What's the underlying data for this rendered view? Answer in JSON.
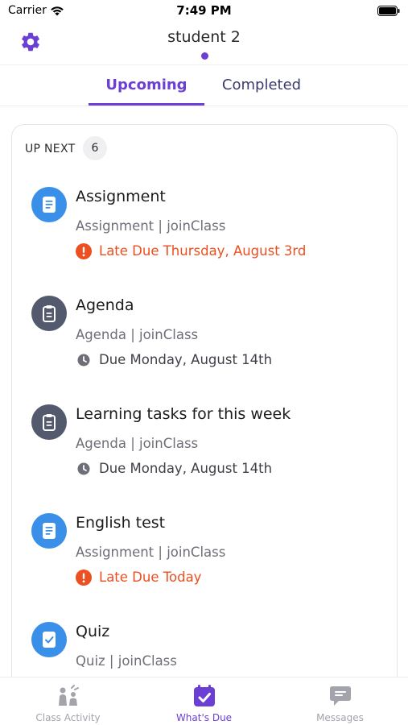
{
  "status_bar": {
    "carrier": "Carrier",
    "time": "7:49 PM"
  },
  "header": {
    "title": "student 2",
    "settings_icon": "gear-icon"
  },
  "tabs": [
    {
      "label": "Upcoming",
      "active": true
    },
    {
      "label": "Completed",
      "active": false
    }
  ],
  "section": {
    "label": "UP NEXT",
    "count": "6"
  },
  "items": [
    {
      "title": "Assignment",
      "subtitle": "Assignment | joinClass",
      "due": "Late Due Thursday, August 3rd",
      "late": true,
      "icon": "document-icon"
    },
    {
      "title": "Agenda",
      "subtitle": "Agenda | joinClass",
      "due": "Due Monday, August 14th",
      "late": false,
      "icon": "clipboard-icon"
    },
    {
      "title": "Learning tasks for this week",
      "subtitle": "Agenda | joinClass",
      "due": "Due Monday, August 14th",
      "late": false,
      "icon": "clipboard-icon"
    },
    {
      "title": "English test",
      "subtitle": "Assignment | joinClass",
      "due": "Late Due Today",
      "late": true,
      "icon": "document-icon"
    },
    {
      "title": "Quiz",
      "subtitle": "Quiz | joinClass",
      "icon": "quiz-check-icon"
    }
  ],
  "bottom_nav": [
    {
      "label": "Class Activity",
      "icon": "class-activity-icon",
      "active": false
    },
    {
      "label": "What's Due",
      "icon": "calendar-check-icon",
      "active": true
    },
    {
      "label": "Messages",
      "icon": "chat-bubble-icon",
      "active": false
    }
  ],
  "colors": {
    "accent": "#6b3fd4",
    "late": "#ec4f20",
    "assignment_icon_bg": "#3a8fe8",
    "agenda_icon_bg": "#545a6d"
  }
}
